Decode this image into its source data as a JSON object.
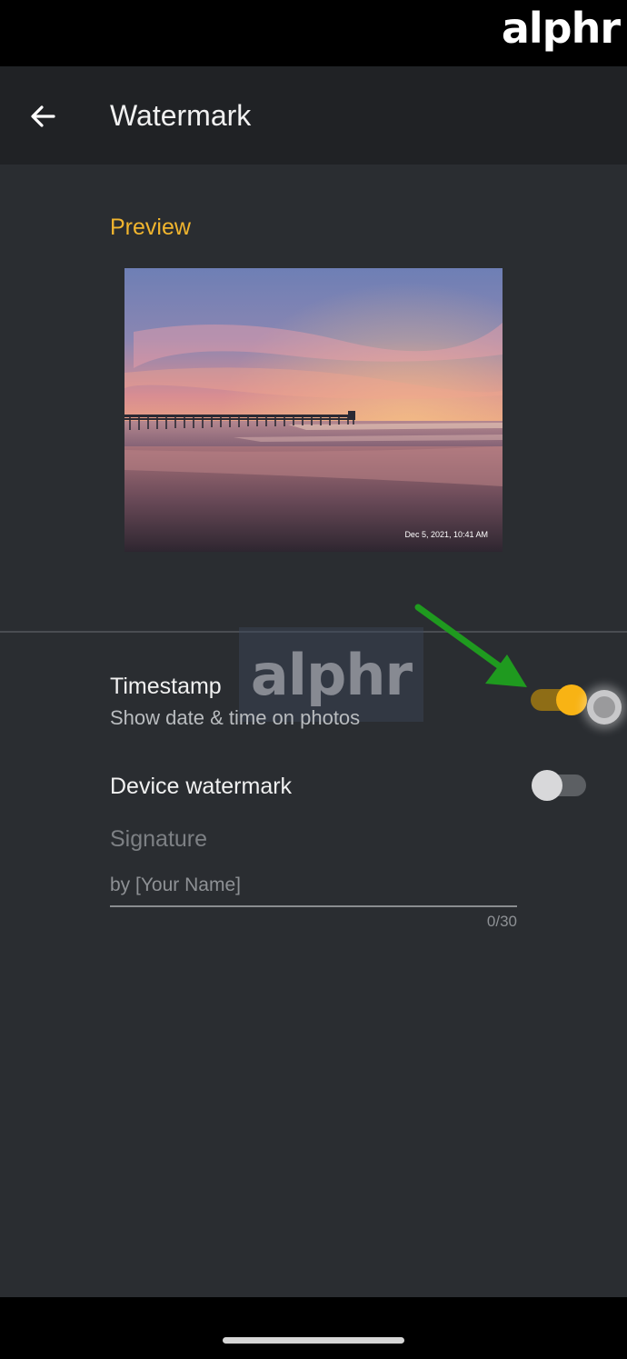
{
  "logo": {
    "text": "alphr"
  },
  "app_bar": {
    "back_icon": "arrow-left-icon",
    "title": "Watermark"
  },
  "preview": {
    "label": "Preview",
    "image_description": "sunset beach with pier",
    "timestamp": "Dec 5, 2021, 10:41 AM"
  },
  "watermark_overlay": {
    "text": "alphr"
  },
  "timestamp_setting": {
    "title": "Timestamp",
    "subtitle": "Show date & time on photos",
    "enabled": true
  },
  "device_watermark": {
    "title": "Device watermark",
    "enabled": false
  },
  "signature": {
    "label": "Signature",
    "placeholder": "by [Your Name]",
    "value": "",
    "counter": "0/30"
  },
  "colors": {
    "accent": "#f1b52e",
    "toggle_on_knob": "#f8b314",
    "toggle_on_track": "#8e6d16",
    "background": "#2a2d31",
    "app_bar": "#202225",
    "annotation_arrow": "#1f9a1f"
  }
}
